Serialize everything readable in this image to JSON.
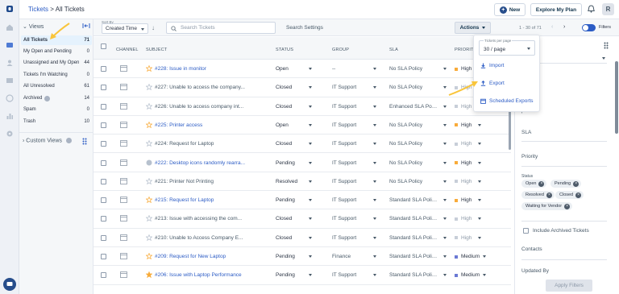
{
  "header": {
    "breadcrumb_root": "Tickets",
    "breadcrumb_sep": ">",
    "breadcrumb_current": "All Tickets",
    "new_label": "New",
    "explore_label": "Explore My Plan",
    "avatar_initial": "R"
  },
  "views": {
    "section_label": "Views",
    "items": [
      {
        "label": "All Tickets",
        "count": "71"
      },
      {
        "label": "My Open and Pending",
        "count": "0"
      },
      {
        "label": "Unassigned and My Open",
        "count": "44"
      },
      {
        "label": "Tickets I'm Watching",
        "count": "0"
      },
      {
        "label": "All Unresolved",
        "count": "61"
      },
      {
        "label": "Archived",
        "count": "14"
      },
      {
        "label": "Spam",
        "count": "0"
      },
      {
        "label": "Trash",
        "count": "10"
      }
    ],
    "custom_label": "Custom Views"
  },
  "toolbar": {
    "sort_caption": "Sort By",
    "sort_value": "Created Time",
    "search_placeholder": "Search Tickets",
    "search_settings": "Search Settings",
    "actions_label": "Actions",
    "pagination": "1 - 30 of 71",
    "filters_label": "Filters"
  },
  "table": {
    "headers": {
      "channel": "CHANNEL",
      "subject": "SUBJECT",
      "status": "STATUS",
      "group": "GROUP",
      "sla": "SLA",
      "priority": "PRIORITY"
    },
    "rows": [
      {
        "subject": "#228: Issue in monitor",
        "status": "Open",
        "group": "--",
        "sla": "No SLA Policy",
        "priority": "High"
      },
      {
        "subject": "#227: Unable to access the company...",
        "status": "Closed",
        "group": "IT Support",
        "sla": "No SLA Policy",
        "priority": "High"
      },
      {
        "subject": "#226: Unable to access company int...",
        "status": "Closed",
        "group": "IT Support",
        "sla": "Enhanced SLA Policy",
        "priority": "High"
      },
      {
        "subject": "#225: Printer access",
        "status": "Open",
        "group": "IT Support",
        "sla": "No SLA Policy",
        "priority": "High"
      },
      {
        "subject": "#224: Request for Laptop",
        "status": "Closed",
        "group": "IT Support",
        "sla": "No SLA Policy",
        "priority": "High"
      },
      {
        "subject": "#222: Desktop icons randomly rearra...",
        "status": "Pending",
        "group": "IT Support",
        "sla": "No SLA Policy",
        "priority": "High"
      },
      {
        "subject": "#221: Printer Not Printing",
        "status": "Resolved",
        "group": "IT Support",
        "sla": "No SLA Policy",
        "priority": "High"
      },
      {
        "subject": "#215: Request for Laptop",
        "status": "Pending",
        "group": "IT Support",
        "sla": "Standard SLA Policy f...",
        "priority": "High"
      },
      {
        "subject": "#213: Issue with accessing the com...",
        "status": "Closed",
        "group": "IT Support",
        "sla": "Standard SLA Policy f...",
        "priority": "High"
      },
      {
        "subject": "#210: Unable to Access Company E...",
        "status": "Closed",
        "group": "IT Support",
        "sla": "Standard SLA Policy f...",
        "priority": "High"
      },
      {
        "subject": "#209: Request for New Laptop",
        "status": "Pending",
        "group": "Finance",
        "sla": "Standard SLA Policy f...",
        "priority": "Medium"
      },
      {
        "subject": "#206: Issue with Laptop Performance",
        "status": "Pending",
        "group": "IT Support",
        "sla": "Standard SLA Policy f...",
        "priority": "Medium"
      }
    ]
  },
  "actions_menu": {
    "per_page_caption": "Tickets per page",
    "per_page_value": "30 / page",
    "items": [
      "Import",
      "Export",
      "Scheduled Exports"
    ]
  },
  "filters": {
    "sla_label": "SLA",
    "priority_label": "Priority",
    "status_label": "Status",
    "status_chips": [
      "Open",
      "Pending",
      "Resolved",
      "Closed",
      "Waiting for Vendor"
    ],
    "include_archived": "Include Archived Tickets",
    "contacts_label": "Contacts",
    "updated_by_label": "Updated By",
    "apply_label": "Apply Filters",
    "response_partial": "ponse"
  },
  "colors": {
    "accent": "#2c5cc5",
    "high_priority": "#f8ab3a",
    "medium_priority": "#6b79d4",
    "annotation_arrow": "#f9c53b"
  }
}
